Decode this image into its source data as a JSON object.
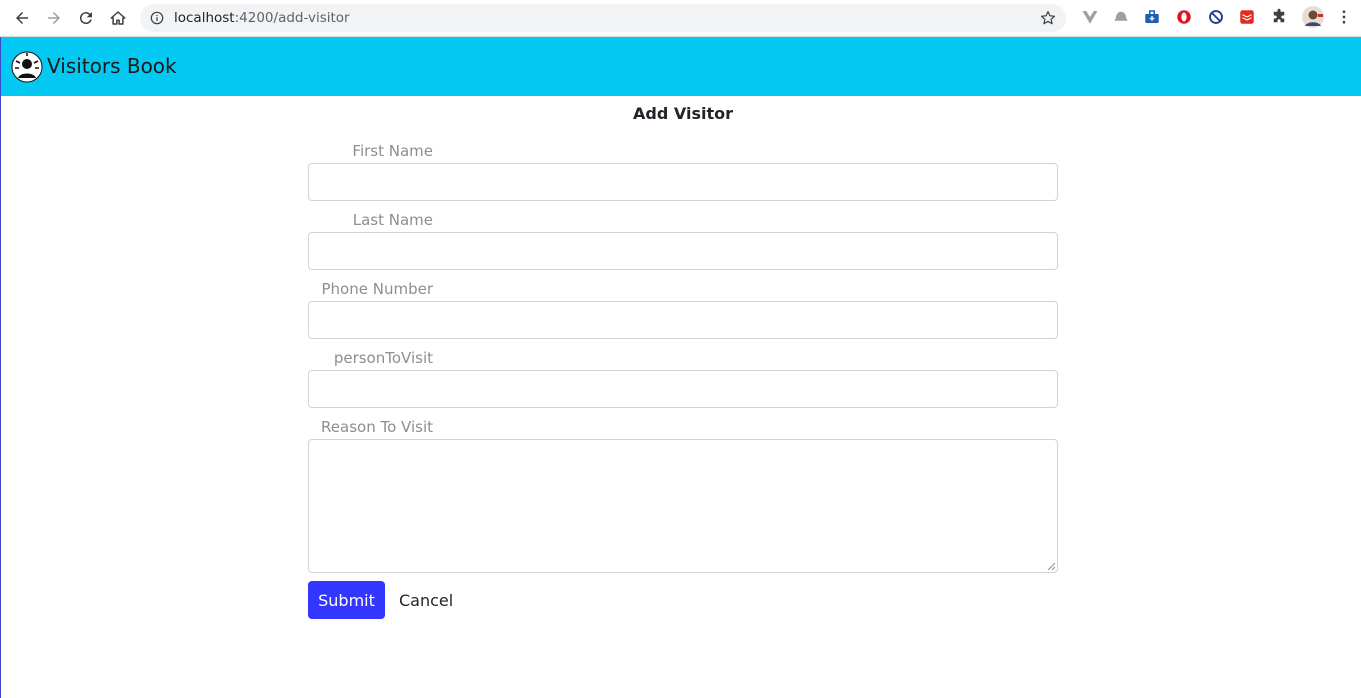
{
  "browser": {
    "url_host": "localhost",
    "url_path": ":4200/add-visitor"
  },
  "navbar": {
    "brand": "Visitors Book",
    "background": "#03c9f2"
  },
  "form": {
    "title": "Add Visitor",
    "fields": [
      {
        "label": "First Name",
        "value": ""
      },
      {
        "label": "Last Name",
        "value": ""
      },
      {
        "label": "Phone Number",
        "value": ""
      },
      {
        "label": "personToVisit",
        "value": ""
      },
      {
        "label": "Reason To Visit",
        "value": ""
      }
    ],
    "submit_label": "Submit",
    "cancel_label": "Cancel",
    "submit_color": "#3336ff"
  }
}
